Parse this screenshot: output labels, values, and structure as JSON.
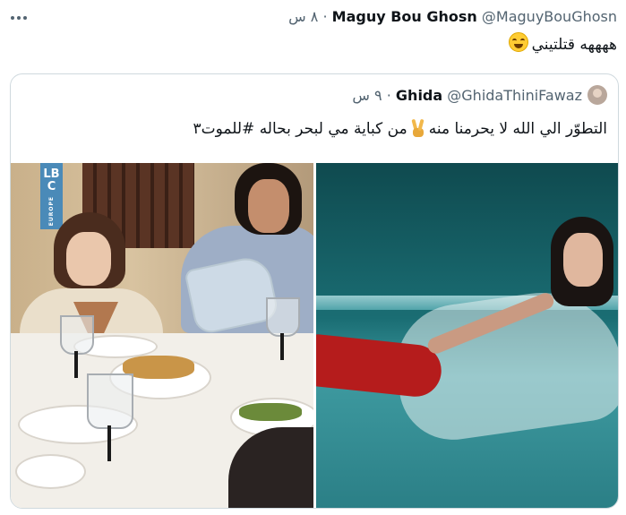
{
  "tweet": {
    "display_name": "Maguy Bou Ghosn",
    "handle": "@MaguyBouGhosn",
    "separator": "·",
    "time": "٨ س",
    "text": "ههههه قتلتيني",
    "emoji": "face-with-tears-of-joy-icon"
  },
  "quoted": {
    "display_name": "Ghida",
    "handle": "@GhidaThiniFawaz",
    "separator": "·",
    "time": "٩ س",
    "text_part1": "التطوّر الي الله لا يحرمنا منه",
    "text_part2": "من كباية مي لبحر بحاله #للموت٣",
    "emoji": "victory-hand-icon"
  },
  "media": {
    "left_logo": {
      "line1": "LB",
      "line2": "C",
      "sub": "EUROPE"
    }
  }
}
